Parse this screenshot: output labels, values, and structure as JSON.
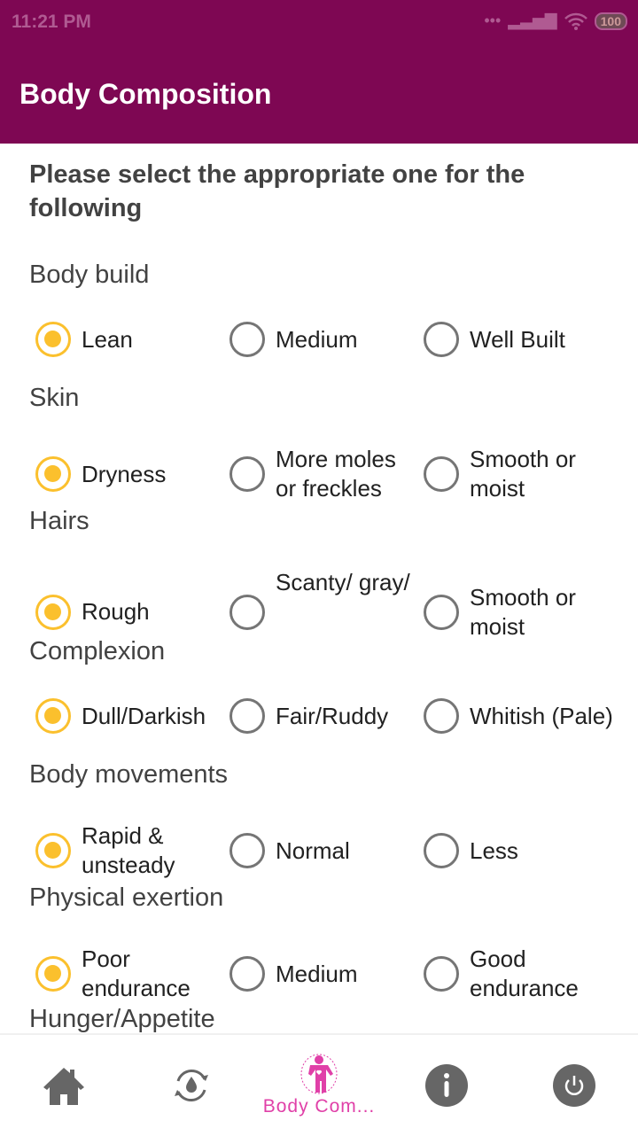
{
  "status_bar": {
    "time": "11:21 PM",
    "battery": "100"
  },
  "app_bar": {
    "title": "Body Composition"
  },
  "intro": "Please select the appropriate one for the following",
  "questions": [
    {
      "label": "Body build",
      "options": [
        "Lean",
        "Medium",
        "Well Built"
      ],
      "selected": 0
    },
    {
      "label": "Skin",
      "options": [
        "Dryness",
        "More moles or freckles",
        "Smooth or moist"
      ],
      "selected": 0
    },
    {
      "label": "Hairs",
      "options": [
        "Rough",
        "Scanty/ gray/",
        "Smooth or moist"
      ],
      "selected": 0
    },
    {
      "label": "Complexion",
      "options": [
        "Dull/Darkish",
        "Fair/Ruddy",
        "Whitish (Pale)"
      ],
      "selected": 0
    },
    {
      "label": "Body movements",
      "options": [
        "Rapid & unsteady",
        "Normal",
        "Less"
      ],
      "selected": 0
    },
    {
      "label": "Physical exertion",
      "options": [
        "Poor endurance",
        "Medium",
        "Good endurance"
      ],
      "selected": 0
    },
    {
      "label": "Hunger/Appetite",
      "options": [],
      "selected": null
    }
  ],
  "bottom_nav": {
    "items": [
      {
        "icon": "home-icon"
      },
      {
        "icon": "water-cycle-icon"
      },
      {
        "icon": "body-icon",
        "label": "Body Com...",
        "active": true
      },
      {
        "icon": "info-icon"
      },
      {
        "icon": "power-icon"
      }
    ],
    "active_color": "#e040a8",
    "inactive_color": "#666666"
  },
  "colors": {
    "primary": "#7e0753",
    "radio_selected": "#fbc02d",
    "radio_unselected": "#757575"
  }
}
